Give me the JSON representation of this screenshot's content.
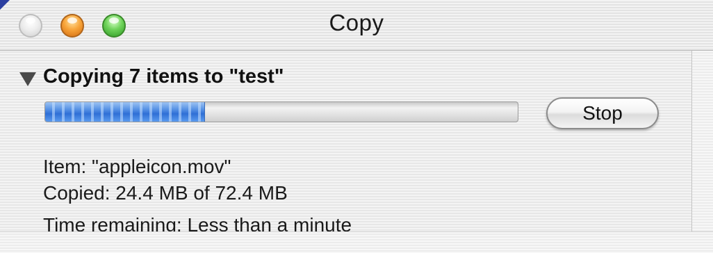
{
  "window": {
    "title": "Copy",
    "buttons": {
      "close": "close-button",
      "minimize": "minimize-button",
      "zoom": "zoom-button"
    }
  },
  "copy": {
    "heading": "Copying 7 items to \"test\"",
    "disclosure_icon": "triangle-down-icon",
    "progress_fraction": 0.337,
    "stop_label": "Stop",
    "item_line": "Item: \"appleicon.mov\"",
    "copied_line": "Copied: 24.4 MB of 72.4 MB",
    "time_line": "Time remaining: Less than a minute"
  },
  "colors": {
    "progress_blue": "#2f6fd6",
    "close_button": "#e6e6e6",
    "minimize_button": "#f8a53a",
    "zoom_button": "#6fd35a"
  }
}
